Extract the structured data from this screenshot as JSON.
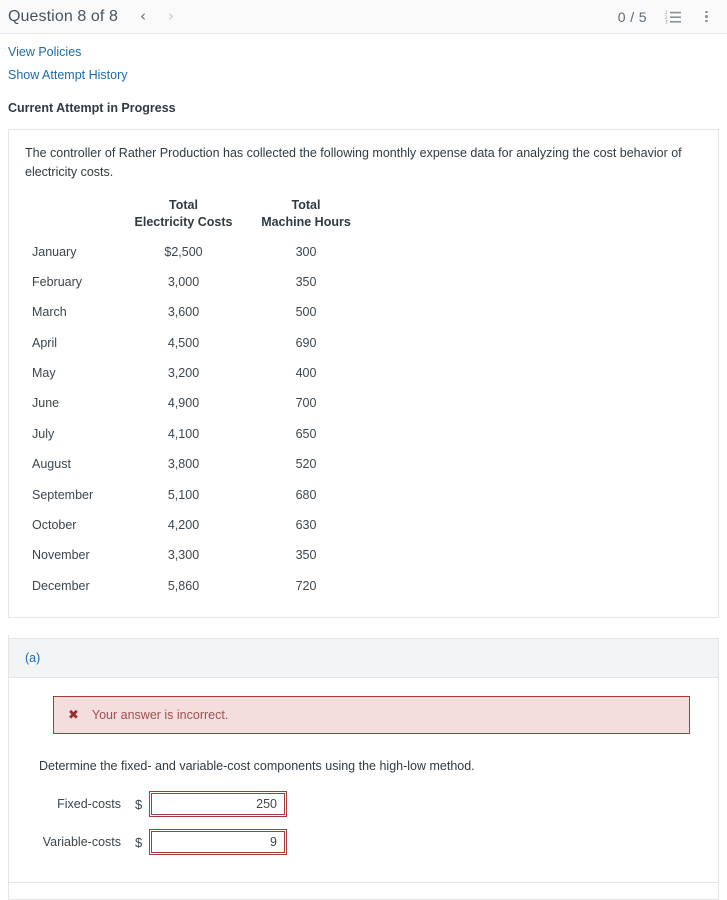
{
  "header": {
    "title": "Question 8 of 8",
    "prev_icon": "chevron-left-icon",
    "next_icon": "chevron-right-icon",
    "score": "0 / 5",
    "list_icon": "numbered-list-icon",
    "menu_icon": "kebab-menu-icon"
  },
  "links": {
    "view_policies": "View Policies",
    "show_attempt_history": "Show Attempt History"
  },
  "attempt_status": "Current Attempt in Progress",
  "question": {
    "prompt": "The controller of Rather Production has collected the following monthly expense data for analyzing the cost behavior of electricity costs.",
    "table": {
      "headers": [
        "",
        "Total\nElectricity Costs",
        "Total\nMachine Hours"
      ],
      "header_line1": [
        "",
        "Total",
        "Total"
      ],
      "header_line2": [
        "",
        "Electricity Costs",
        "Machine Hours"
      ],
      "rows": [
        {
          "month": "January",
          "cost": "$2,500",
          "hours": "300"
        },
        {
          "month": "February",
          "cost": "3,000",
          "hours": "350"
        },
        {
          "month": "March",
          "cost": "3,600",
          "hours": "500"
        },
        {
          "month": "April",
          "cost": "4,500",
          "hours": "690"
        },
        {
          "month": "May",
          "cost": "3,200",
          "hours": "400"
        },
        {
          "month": "June",
          "cost": "4,900",
          "hours": "700"
        },
        {
          "month": "July",
          "cost": "4,100",
          "hours": "650"
        },
        {
          "month": "August",
          "cost": "3,800",
          "hours": "520"
        },
        {
          "month": "September",
          "cost": "5,100",
          "hours": "680"
        },
        {
          "month": "October",
          "cost": "4,200",
          "hours": "630"
        },
        {
          "month": "November",
          "cost": "3,300",
          "hours": "350"
        },
        {
          "month": "December",
          "cost": "5,860",
          "hours": "720"
        }
      ]
    }
  },
  "part_a": {
    "label": "(a)",
    "alert": {
      "icon": "x-mark-icon",
      "text": "Your answer is incorrect."
    },
    "instruction": "Determine the fixed- and variable-cost components using the high-low method.",
    "fields": [
      {
        "label": "Fixed-costs",
        "currency": "$",
        "value": "250"
      },
      {
        "label": "Variable-costs",
        "currency": "$",
        "value": "9"
      }
    ]
  },
  "colors": {
    "link": "#1b6ca8",
    "error_border": "#a03c3c",
    "error_bg": "#f3dddd",
    "error_text": "#a0514f",
    "text": "#2f3a42",
    "topbar_bg": "#fafafa",
    "section_head_bg": "#f3f4f5"
  }
}
